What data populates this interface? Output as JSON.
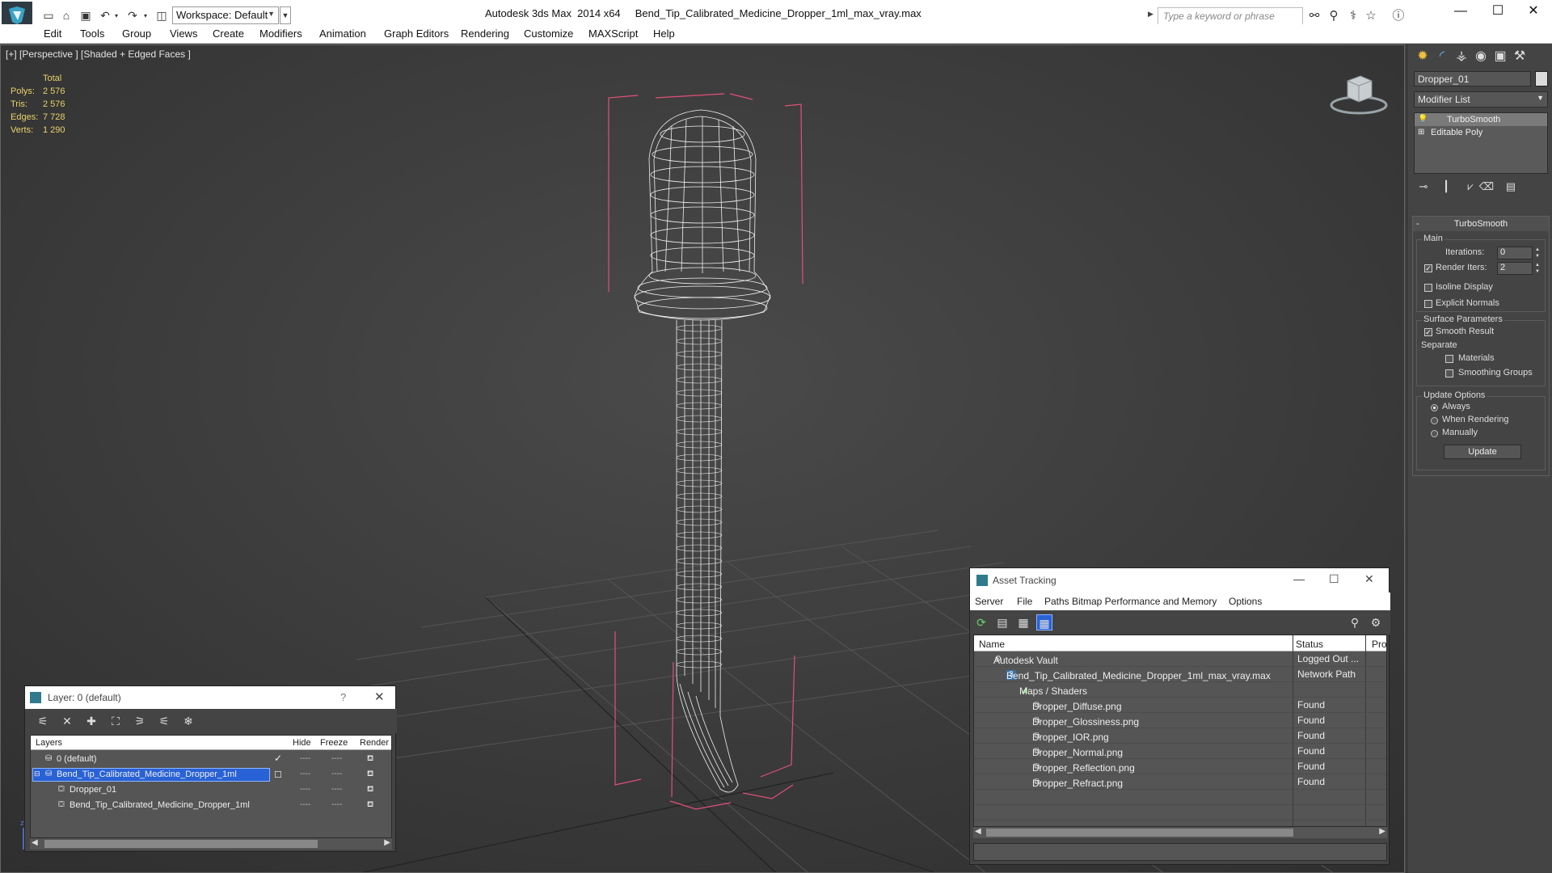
{
  "titlebar": {
    "workspace_label": "Workspace: Default",
    "app_title": "Autodesk 3ds Max  2014 x64",
    "file_title": "Bend_Tip_Calibrated_Medicine_Dropper_1ml_max_vray.max",
    "search_placeholder": "Type a keyword or phrase"
  },
  "menu": [
    "Edit",
    "Tools",
    "Group",
    "Views",
    "Create",
    "Modifiers",
    "Animation",
    "Graph Editors",
    "Rendering",
    "Customize",
    "MAXScript",
    "Help"
  ],
  "viewport": {
    "label": "[+] [Perspective ] [Shaded + Edged Faces ]",
    "stats": {
      "header": "Total",
      "rows": [
        {
          "k": "Polys:",
          "v": "2 576"
        },
        {
          "k": "Tris:",
          "v": "2 576"
        },
        {
          "k": "Edges:",
          "v": "7 728"
        },
        {
          "k": "Verts:",
          "v": "1 290"
        }
      ]
    }
  },
  "command_panel": {
    "object_name": "Dropper_01",
    "modifier_list": "Modifier List",
    "stack": [
      "TurboSmooth",
      "Editable Poly"
    ],
    "rollout_title": "TurboSmooth",
    "main_group": "Main",
    "iterations_label": "Iterations:",
    "iterations_value": "0",
    "render_iters_label": "Render Iters:",
    "render_iters_value": "2",
    "isoline_label": "Isoline Display",
    "explicit_normals_label": "Explicit Normals",
    "surface_group": "Surface Parameters",
    "smooth_result_label": "Smooth Result",
    "separate_label": "Separate",
    "materials_label": "Materials",
    "smoothing_groups_label": "Smoothing Groups",
    "update_group": "Update Options",
    "always_label": "Always",
    "when_rendering_label": "When Rendering",
    "manually_label": "Manually",
    "update_button": "Update"
  },
  "layer_dialog": {
    "title": "Layer: 0 (default)",
    "help": "?",
    "columns": {
      "layers": "Layers",
      "hide": "Hide",
      "freeze": "Freeze",
      "render": "Render"
    },
    "rows": [
      {
        "name": "0 (default)"
      },
      {
        "name": "Bend_Tip_Calibrated_Medicine_Dropper_1ml"
      },
      {
        "name": "Dropper_01"
      },
      {
        "name": "Bend_Tip_Calibrated_Medicine_Dropper_1ml"
      }
    ]
  },
  "asset_tracking": {
    "title": "Asset Tracking",
    "menu": [
      "Server",
      "File",
      "Paths",
      "Bitmap Performance and Memory",
      "Options"
    ],
    "columns": {
      "name": "Name",
      "status": "Status",
      "proxy": "Prox"
    },
    "rows": [
      {
        "name": "Autodesk Vault",
        "status": "Logged Out ..."
      },
      {
        "name": "Bend_Tip_Calibrated_Medicine_Dropper_1ml_max_vray.max",
        "status": "Network Path"
      },
      {
        "name": "Maps / Shaders",
        "status": ""
      },
      {
        "name": "Dropper_Diffuse.png",
        "status": "Found"
      },
      {
        "name": "Dropper_Glossiness.png",
        "status": "Found"
      },
      {
        "name": "Dropper_IOR.png",
        "status": "Found"
      },
      {
        "name": "Dropper_Normal.png",
        "status": "Found"
      },
      {
        "name": "Dropper_Reflection.png",
        "status": "Found"
      },
      {
        "name": "Dropper_Refract.png",
        "status": "Found"
      }
    ]
  },
  "colors": {
    "selection_blue": "#2962d6",
    "stats_yellow": "#e8d26a",
    "bbox_pink": "#e0507a",
    "wire_white": "#f0f0f0"
  }
}
